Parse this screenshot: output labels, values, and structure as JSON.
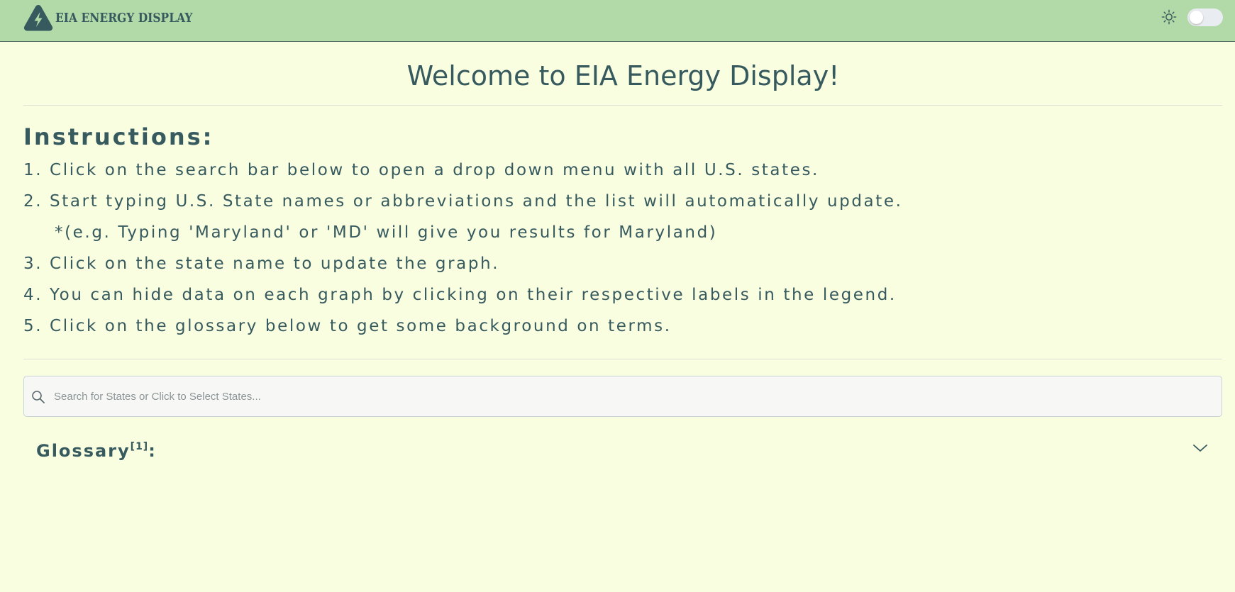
{
  "header": {
    "brand_name": "EIA ENERGY DISPLAY",
    "logo_icon": "triangle-bolt-icon",
    "theme_icon": "sun-icon",
    "theme_toggle_on": false
  },
  "main": {
    "title": "Welcome to EIA Energy Display!",
    "instructions": {
      "heading": "Instructions:",
      "steps": [
        "1. Click on the search bar below to open a drop down menu with all U.S. states.",
        "2. Start typing U.S. State names or abbreviations and the list will automatically update.",
        "*(e.g. Typing 'Maryland' or 'MD' will give you results for Maryland)",
        "3. Click on the state name to update the graph.",
        "4. You can hide data on each graph by clicking on their respective labels in the legend.",
        "5. Click on the glossary below to get some background on terms."
      ]
    },
    "search": {
      "placeholder": "Search for States or Click to Select States...",
      "value": ""
    },
    "glossary": {
      "label": "Glossary",
      "footnote": "[1]",
      "colon": ":",
      "expanded": false
    }
  },
  "colors": {
    "header_bg": "#b2d9a8",
    "page_bg": "#fafee1",
    "text": "#375a5e",
    "search_bg": "#f7f8f6"
  }
}
